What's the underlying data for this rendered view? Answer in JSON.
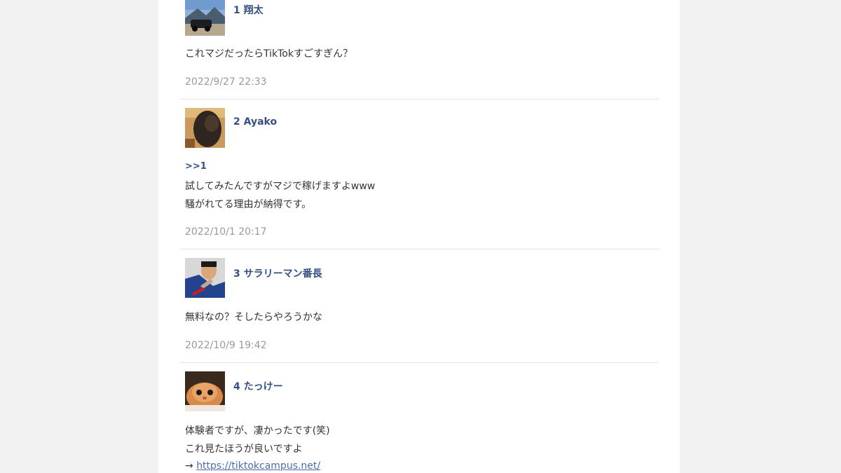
{
  "comments": [
    {
      "number": "1",
      "name": "翔太",
      "lines": [
        "これマジだったらTikTokすごすぎん？"
      ],
      "date": "2022/9/27 22:33"
    },
    {
      "number": "2",
      "name": "Ayako",
      "reply": ">>1",
      "lines": [
        "試してみたんですがマジで稼げますよwww",
        "騒がれてる理由が納得です。"
      ],
      "date": "2022/10/1 20:17"
    },
    {
      "number": "3",
      "name": "サラリーマン番長",
      "lines": [
        "無料なの？そしたらやろうかな"
      ],
      "date": "2022/10/9 19:42"
    },
    {
      "number": "4",
      "name": "たっけー",
      "lines": [
        "体験者ですが、凄かったです(笑)",
        "これ見たほうが良いですよ"
      ],
      "arrow": "→",
      "link": "https://tiktokcampus.net/"
    }
  ],
  "colors": {
    "name": "#345084",
    "date": "#999999",
    "text": "#333333",
    "link": "#4a6fa8"
  }
}
